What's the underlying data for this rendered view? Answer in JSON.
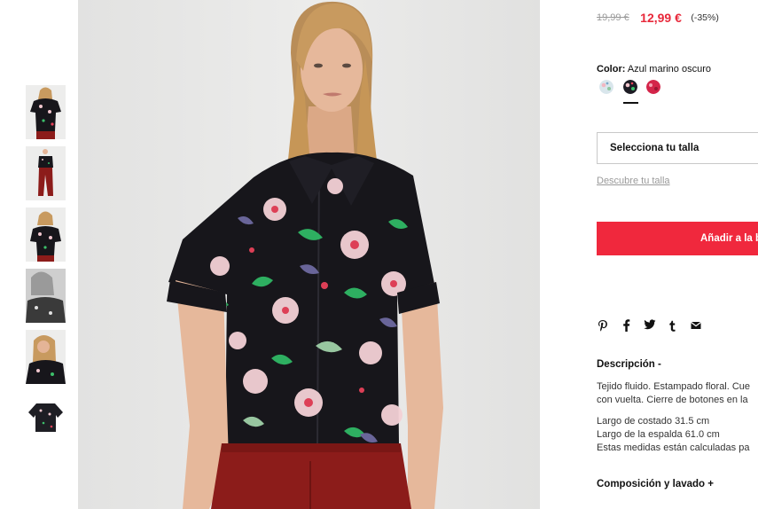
{
  "gallery": {
    "thumbnails": [
      {
        "name": "thumbnail-1-front"
      },
      {
        "name": "thumbnail-2-full-body"
      },
      {
        "name": "thumbnail-3-closeup"
      },
      {
        "name": "thumbnail-4-bw-portrait"
      },
      {
        "name": "thumbnail-5-portrait"
      },
      {
        "name": "thumbnail-6-flat-lay"
      }
    ],
    "colors": {
      "background": "#e7e7e6",
      "shirt": "#17161b",
      "trousers": "#8c1c1a",
      "skin": "#e4b497",
      "hair": "#c89a5f"
    }
  },
  "product": {
    "old_price": "19,99 €",
    "new_price": "12,99 €",
    "discount": "(-35%)",
    "color_label": "Color:",
    "color_value": "Azul marino oscuro",
    "swatches": [
      {
        "name": "swatch-light-print",
        "color": "#cfe0e8",
        "selected": false
      },
      {
        "name": "swatch-navy-print",
        "color": "#1d1c24",
        "selected": true
      },
      {
        "name": "swatch-red-print",
        "color": "#d4254a",
        "selected": false
      }
    ],
    "size_placeholder": "Selecciona tu talla",
    "size_guide": "Descubre tu talla",
    "add_to_bag": "Añadir a la b",
    "share_icons": [
      "pinterest-icon",
      "facebook-icon",
      "twitter-icon",
      "tumblr-icon",
      "email-icon"
    ],
    "description": {
      "title": "Descripción -",
      "lines": [
        "Tejido fluido. Estampado floral. Cue",
        "con vuelta. Cierre de botones en la",
        "Largo de costado 31.5 cm",
        "Largo de la espalda 61.0 cm",
        "Estas medidas están calculadas pa"
      ]
    },
    "composition_title": "Composición y lavado +",
    "accent_color": "#f0283d",
    "price_color": "#e8283a"
  }
}
